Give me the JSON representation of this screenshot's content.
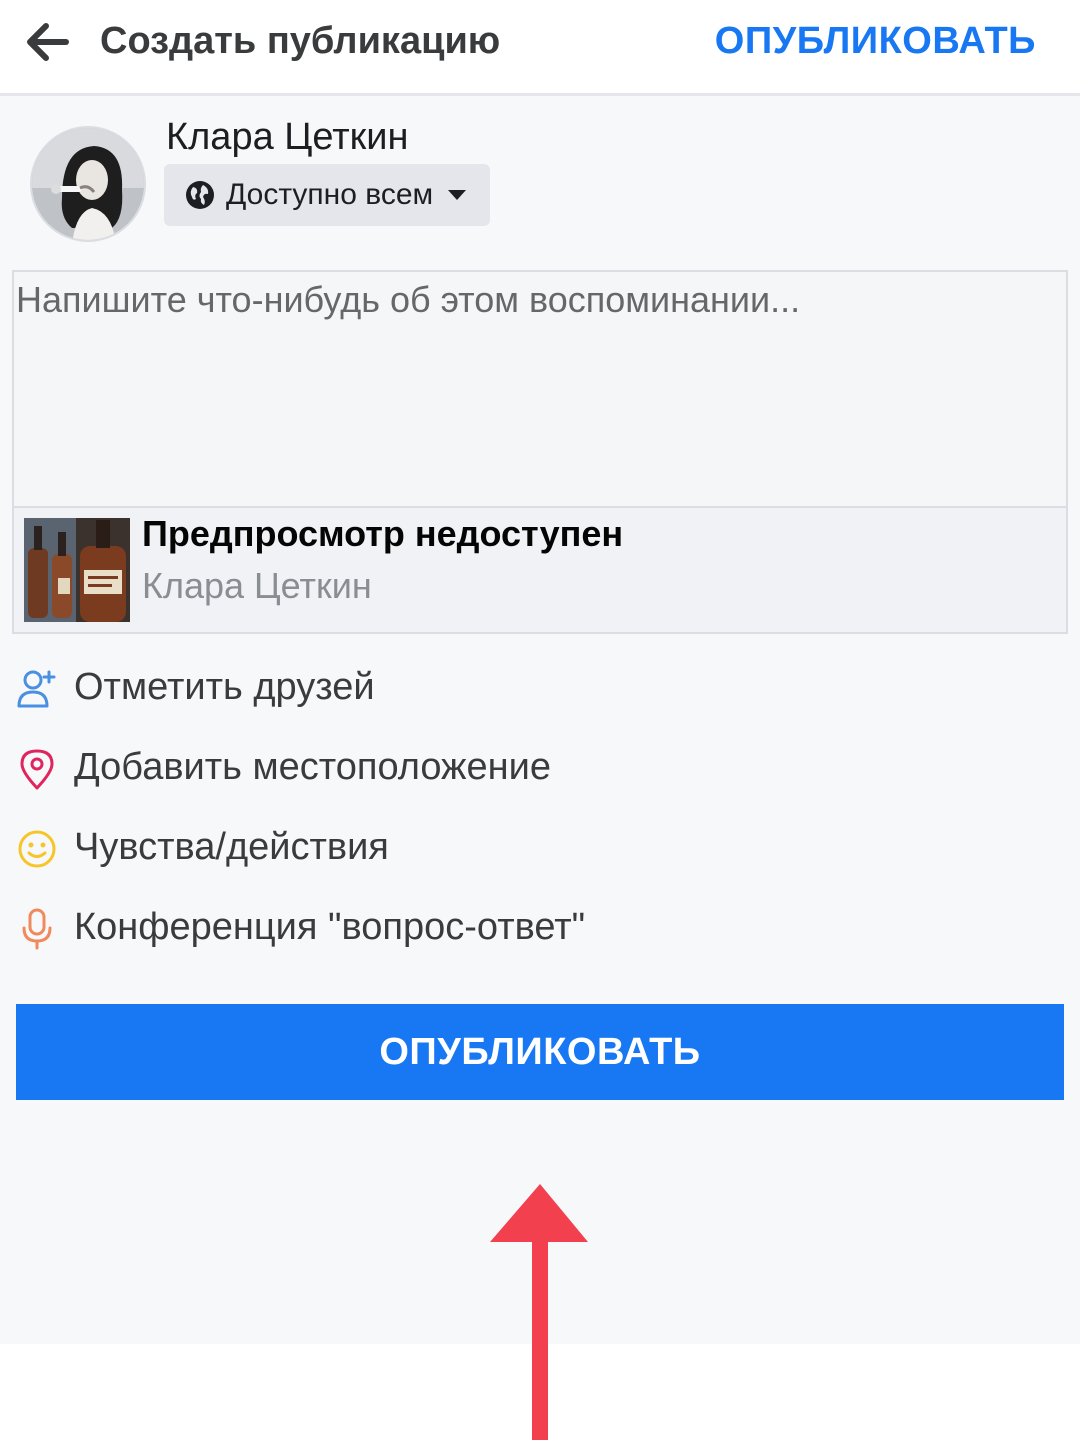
{
  "header": {
    "title": "Создать публикацию",
    "publish_label": "ОПУБЛИКОВАТЬ",
    "back_icon": "arrow-left-icon"
  },
  "author": {
    "name": "Клара Цеткин",
    "privacy_label": "Доступно всем",
    "privacy_icon": "globe-icon"
  },
  "composer": {
    "placeholder": "Напишите что-нибудь об этом воспоминании..."
  },
  "preview": {
    "title": "Предпросмотр недоступен",
    "subtitle": "Клара Цеткин"
  },
  "options": [
    {
      "label": "Отметить друзей",
      "icon": "tag-friends-icon",
      "color": "#4a90e2"
    },
    {
      "label": "Добавить местоположение",
      "icon": "location-pin-icon",
      "color": "#e0245e"
    },
    {
      "label": "Чувства/действия",
      "icon": "smiley-icon",
      "color": "#f7c52a"
    },
    {
      "label": "Конференция \"вопрос-ответ\"",
      "icon": "microphone-icon",
      "color": "#f08a5d"
    }
  ],
  "publish_button": {
    "label": "ОПУБЛИКОВАТЬ"
  },
  "colors": {
    "accent": "#1877f2",
    "annotation_arrow": "#f2404f",
    "background": "#f7f8fa"
  }
}
